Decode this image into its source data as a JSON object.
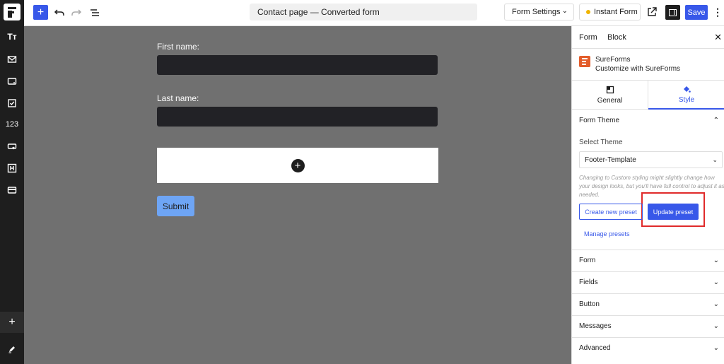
{
  "rail": {
    "items": [
      {
        "icon": "text-icon",
        "label": "Tт"
      },
      {
        "icon": "mail-icon"
      },
      {
        "icon": "input-icon"
      },
      {
        "icon": "checkbox-icon"
      },
      {
        "icon": "number-icon",
        "label": "123"
      },
      {
        "icon": "dropdown-icon"
      },
      {
        "icon": "heading-icon"
      },
      {
        "icon": "payment-icon"
      }
    ]
  },
  "topbar": {
    "document_title": "Contact page — Converted form",
    "form_settings_label": "Form Settings",
    "instant_form_label": "Instant Form",
    "save_label": "Save"
  },
  "canvas": {
    "first_name_label": "First name:",
    "last_name_label": "Last name:",
    "submit_label": "Submit"
  },
  "sidebar": {
    "tabs": {
      "form": "Form",
      "block": "Block"
    },
    "plugin": {
      "name": "SureForms",
      "description": "Customize with SureForms"
    },
    "general_label": "General",
    "style_label": "Style",
    "form_theme": {
      "title": "Form Theme",
      "select_label": "Select Theme",
      "selected_theme": "Footer-Template",
      "help_text": "Changing to Custom styling might slightly change how your design looks, but you'll have full control to adjust it as needed.",
      "create_preset": "Create new preset",
      "update_preset": "Update preset",
      "manage_presets": "Manage presets"
    },
    "sections": [
      "Form",
      "Fields",
      "Button",
      "Messages",
      "Advanced"
    ]
  },
  "colors": {
    "accent": "#3858e9",
    "highlight": "#e02b2b",
    "canvas_bg": "#707070",
    "field_bg": "#222226",
    "submit_bg": "#6ea5f5"
  }
}
